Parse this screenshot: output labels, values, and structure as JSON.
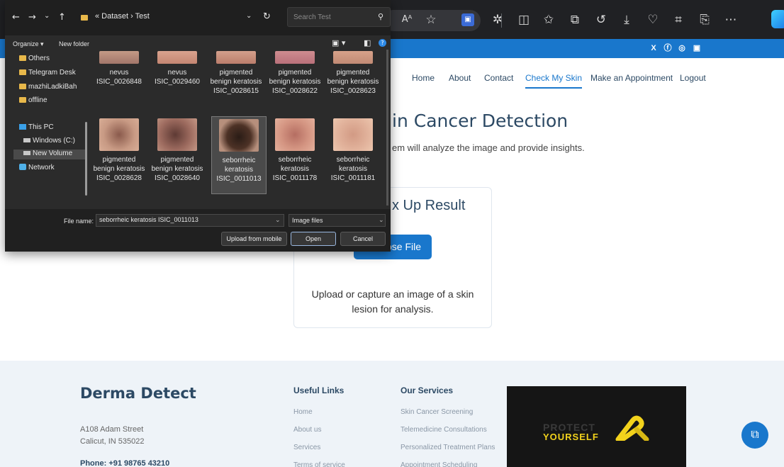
{
  "browser": {
    "reader_label": "Aᴬ"
  },
  "site": {
    "nav": [
      {
        "label": "Home"
      },
      {
        "label": "About"
      },
      {
        "label": "Contact"
      },
      {
        "label": "Check My Skin"
      },
      {
        "label": "Make an Appointment"
      },
      {
        "label": "Logout"
      }
    ],
    "hero_title": "in Cancer Detection",
    "hero_sub": "em will analyze the image and provide insights.",
    "card_title": "x Up Result",
    "choose_button": "ose File",
    "card_desc": "Upload or capture an image of a skin lesion for analysis."
  },
  "footer": {
    "brand": "Derma Detect",
    "address_line1": "A108 Adam Street",
    "address_line2": "Calicut, IN 535022",
    "phone": "Phone: +91 98765 43210",
    "useful_links": {
      "title": "Useful Links",
      "items": [
        "Home",
        "About us",
        "Services",
        "Terms of service"
      ]
    },
    "services": {
      "title": "Our Services",
      "items": [
        "Skin Cancer Screening",
        "Telemedicine Consultations",
        "Personalized Treatment Plans",
        "Appointment Scheduling"
      ]
    },
    "promo_top": "PROTECT",
    "promo_bottom": "YOURSELF"
  },
  "dialog": {
    "breadcrumb": "«  Dataset  ›  Test",
    "search_placeholder": "Search Test",
    "organize": "Organize ▾",
    "new_folder": "New folder",
    "nav_items": [
      {
        "label": "Others"
      },
      {
        "label": "Telegram Desk"
      },
      {
        "label": "mazhiLadkiBah"
      },
      {
        "label": "offline"
      },
      {
        "label": "This PC"
      },
      {
        "label": "Windows (C:)"
      },
      {
        "label": "New Volume"
      },
      {
        "label": "Network"
      }
    ],
    "files_row1": [
      {
        "name": "nevus ISIC_0026848"
      },
      {
        "name": "nevus ISIC_0029460"
      },
      {
        "name": "pigmented benign keratosis ISIC_0028615"
      },
      {
        "name": "pigmented benign keratosis ISIC_0028622"
      },
      {
        "name": "pigmented benign keratosis ISIC_0028623"
      }
    ],
    "files_row2": [
      {
        "name": "pigmented benign keratosis ISIC_0028628"
      },
      {
        "name": "pigmented benign keratosis ISIC_0028640"
      },
      {
        "name": "seborrheic keratosis ISIC_0011013"
      },
      {
        "name": "seborrheic keratosis ISIC_0011178"
      },
      {
        "name": "seborrheic keratosis ISIC_0011181"
      }
    ],
    "filename_label": "File name:",
    "filename_value": "seborrheic keratosis ISIC_0011013",
    "filetype": "Image files",
    "upload_mobile": "Upload from mobile",
    "open": "Open",
    "cancel": "Cancel"
  },
  "colors": {
    "brand_blue": "#1977cc",
    "dialog_bg": "#2b2b2b"
  }
}
